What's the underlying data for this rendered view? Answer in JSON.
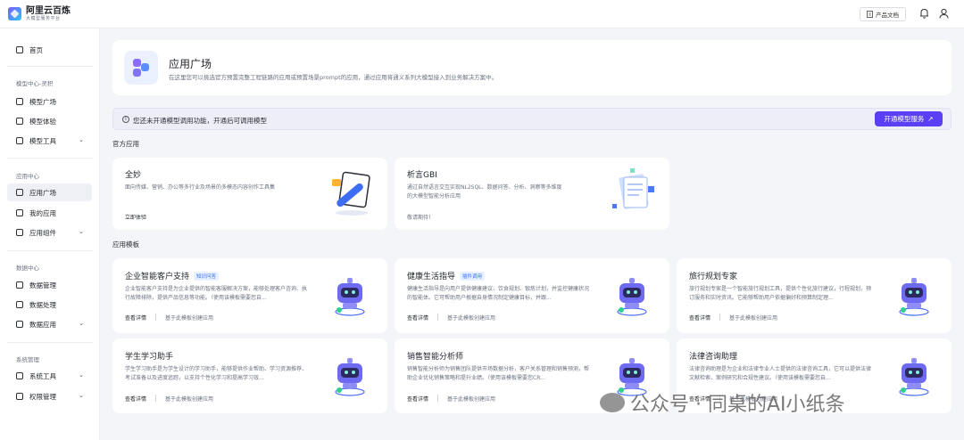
{
  "header": {
    "logo_title": "阿里云百炼",
    "logo_subtitle": "大模型服务平台",
    "doc_button": "产品文档"
  },
  "sidebar": {
    "home": "首页",
    "group1": "模型中心-灵积",
    "model_square": "模型广场",
    "model_experience": "模型体验",
    "model_tools": "模型工具",
    "group2": "应用中心",
    "app_square": "应用广场",
    "my_apps": "我的应用",
    "app_components": "应用组件",
    "group3": "数据中心",
    "data_management": "数据管理",
    "data_processing": "数据处理",
    "data_application": "数据应用",
    "group4": "系统管理",
    "system_tools": "系统工具",
    "permission_management": "权限管理"
  },
  "hero": {
    "title": "应用广场",
    "desc": "在这里您可以挑选官方预置完整工程链路的应用或预置场景prompt的应用，通过应用将通义系列大模型接入到业务解决方案中。"
  },
  "notice": {
    "text": "您还未开通模型调用功能，开通后可调用模型",
    "button": "开通模型服务"
  },
  "official_section": "官方应用",
  "official_apps": [
    {
      "title": "全妙",
      "desc": "面向传媒、营销、办公等多行业及场景的多模态内容创作工具集",
      "link": "立即体验"
    },
    {
      "title": "析言GBI",
      "desc": "通过自然语言交互实现NL2SQL、数据问答、分析、洞察等多维度的大模型智能分析应用",
      "link": "敬请期待！"
    }
  ],
  "template_section": "应用模板",
  "templates": [
    {
      "title": "企业智能客户支持",
      "tag": "知识问答",
      "desc": "企业智能客户支持是为企业提供的智能客服解决方案，能够处理客户咨询、执行故障排除，提供产品信息等功能。（使用该模板需要您自...",
      "detail": "查看详情",
      "create": "基于此模板创建应用"
    },
    {
      "title": "健康生活指导",
      "tag": "插件调用",
      "desc": "健康生活指导是向用户提供健康建议、饮食规划、锻炼计划，并监控健康状况的智能体。它可帮助用户根据自身情况制定健康目标，并跟...",
      "detail": "查看详情",
      "create": "基于此模板创建应用"
    },
    {
      "title": "旅行规划专家",
      "tag": "",
      "desc": "旅行规划专家是一个智能旅行规划工具，提供个性化旅行建议，行程规划，预订服务和实时资讯。它能够帮助用户依据偏好和预算制定理...",
      "detail": "查看详情",
      "create": "基于此模板创建应用"
    },
    {
      "title": "学生学习助手",
      "tag": "",
      "desc": "学生学习助手是为学生设计的学习助手，能够提供作业帮助、学习资源推荐、考试准备以及进度追踪，以支持个性化学习和提高学习效...",
      "detail": "查看详情",
      "create": "基于此模板创建应用"
    },
    {
      "title": "销售智能分析师",
      "tag": "",
      "desc": "销售智能分析师为销售团队提供市场数据分析，客户关系管理和销售预测，帮助企业优化销售策略和提升业绩。（使用该模板需要您CR...",
      "detail": "查看详情",
      "create": "基于此模板创建应用"
    },
    {
      "title": "法律咨询助理",
      "tag": "",
      "desc": "法律咨询助理是为企业和法律专业人士提供的法律咨询工具，它可以提供法律文献检索、案例研究和合规性建议。（使用该模板需要您自...",
      "detail": "查看详情",
      "create": "基于此模板创建应用"
    }
  ],
  "watermark": "公众号 · 同桌的AI小纸条",
  "colors": {
    "primary": "#5b3ff5",
    "tag_bg": "#e8f1ff",
    "tag_text": "#2f6ef6",
    "page_bg": "#f4f5f9"
  }
}
